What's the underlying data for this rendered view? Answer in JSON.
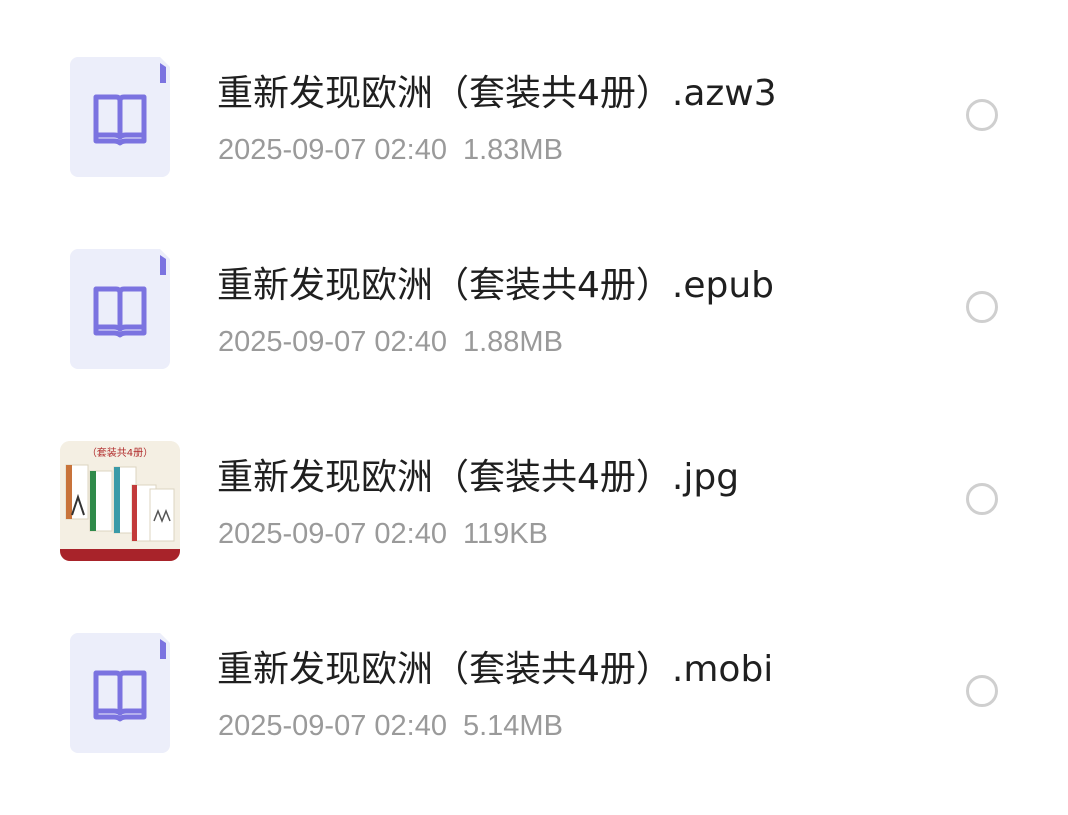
{
  "files": [
    {
      "name": "重新发现欧洲（套装共4册）.azw3",
      "date": "2025-09-07 02:40",
      "size": "1.83MB",
      "icon": "book-icon"
    },
    {
      "name": "重新发现欧洲（套装共4册）.epub",
      "date": "2025-09-07 02:40",
      "size": "1.88MB",
      "icon": "book-icon"
    },
    {
      "name": "重新发现欧洲（套装共4册）.jpg",
      "date": "2025-09-07 02:40",
      "size": "119KB",
      "icon": "image-thumbnail",
      "thumb_caption": "（套装共4册）"
    },
    {
      "name": "重新发现欧洲（套装共4册）.mobi",
      "date": "2025-09-07 02:40",
      "size": "5.14MB",
      "icon": "book-icon"
    }
  ],
  "colors": {
    "icon_accent": "#7b73e0",
    "icon_bg": "#eceefa",
    "meta_text": "#9a9a9a",
    "radio_border": "#cfcfcf"
  }
}
